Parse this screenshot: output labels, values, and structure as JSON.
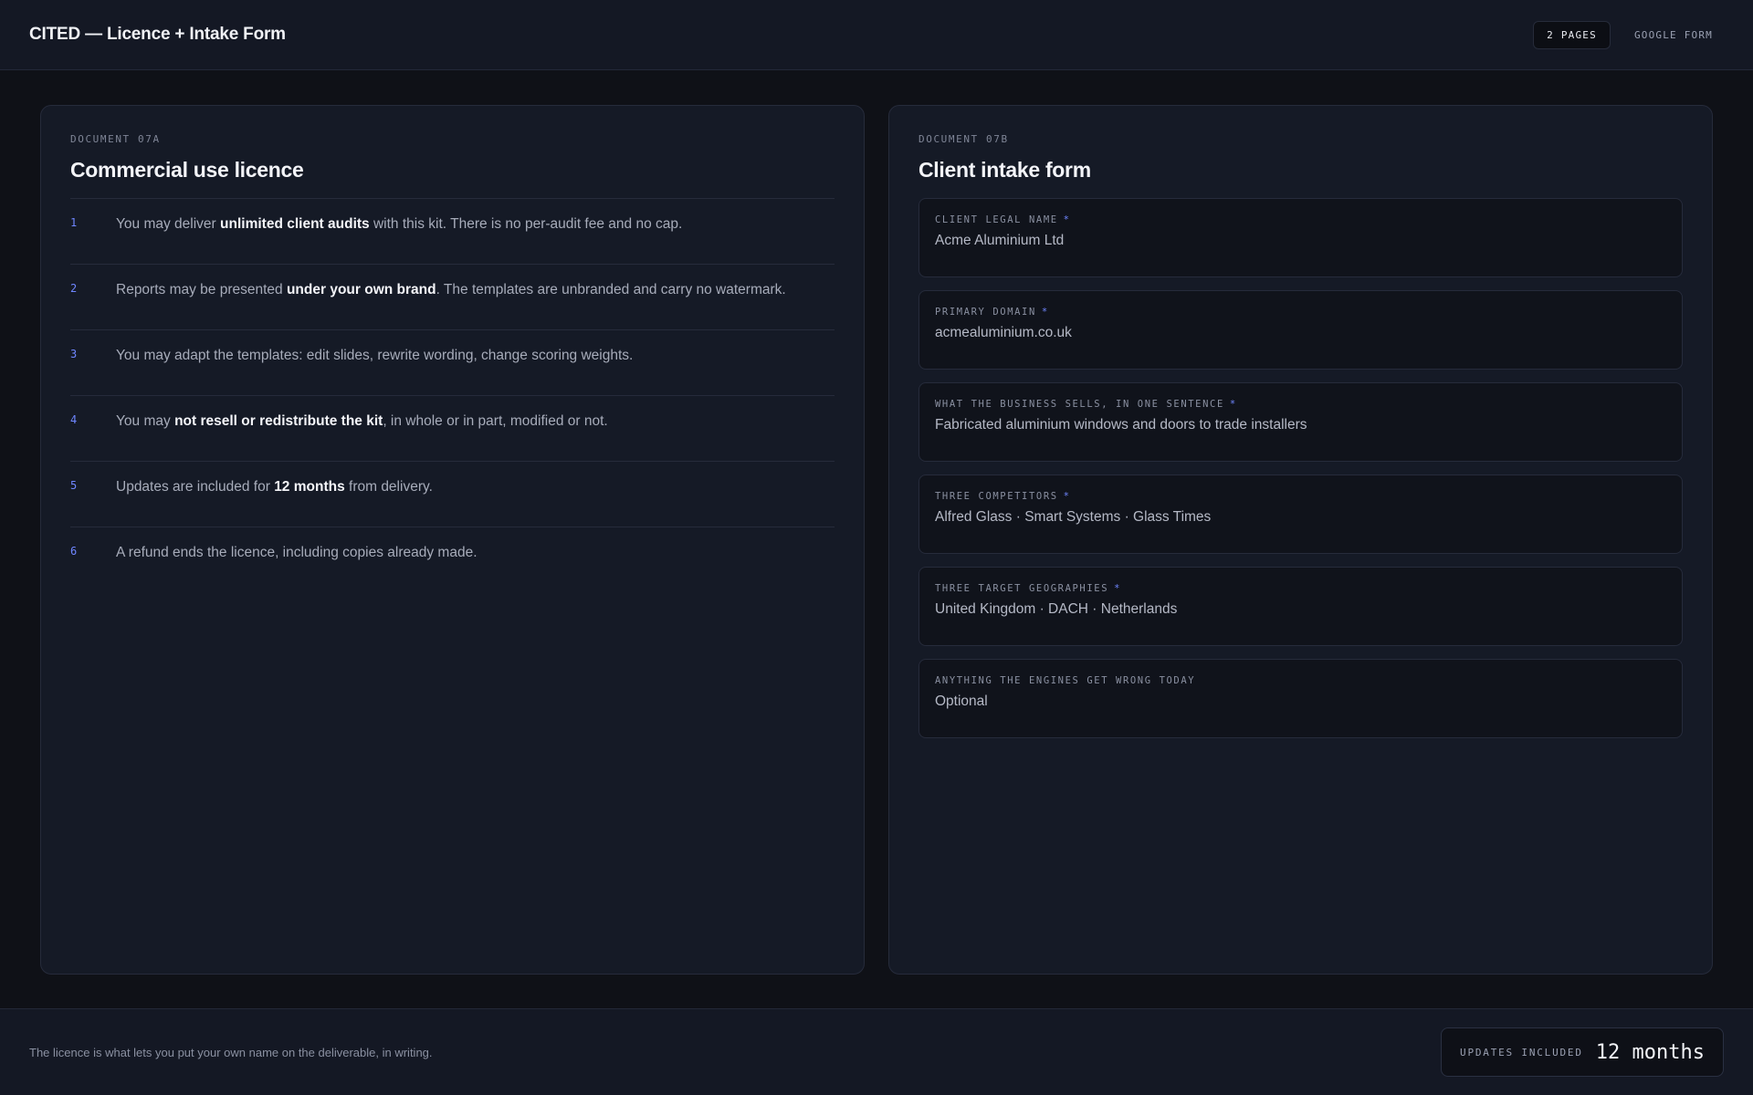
{
  "header": {
    "title": "CITED — Licence + Intake Form",
    "pages_badge": "2 PAGES",
    "google_form_link": "GOOGLE FORM"
  },
  "licence": {
    "kicker": "DOCUMENT 07A",
    "title": "Commercial use licence",
    "terms": [
      {
        "num": "1",
        "parts": [
          [
            "You may deliver ",
            false
          ],
          [
            "unlimited client audits",
            true
          ],
          [
            " with this kit. There is no per-audit fee and no cap.",
            false
          ]
        ]
      },
      {
        "num": "2",
        "parts": [
          [
            "Reports may be presented ",
            false
          ],
          [
            "under your own brand",
            true
          ],
          [
            ". The templates are unbranded and carry no watermark.",
            false
          ]
        ]
      },
      {
        "num": "3",
        "parts": [
          [
            "You may adapt the templates: edit slides, rewrite wording, change scoring weights.",
            false
          ]
        ]
      },
      {
        "num": "4",
        "parts": [
          [
            "You may ",
            false
          ],
          [
            "not resell or redistribute the kit",
            true
          ],
          [
            ", in whole or in part, modified or not.",
            false
          ]
        ]
      },
      {
        "num": "5",
        "parts": [
          [
            "Updates are included for ",
            false
          ],
          [
            "12 months",
            true
          ],
          [
            " from delivery.",
            false
          ]
        ]
      },
      {
        "num": "6",
        "parts": [
          [
            "A refund ends the licence, including copies already made.",
            false
          ]
        ]
      }
    ]
  },
  "intake": {
    "kicker": "DOCUMENT 07B",
    "title": "Client intake form",
    "required_marker": "*",
    "fields": [
      {
        "label": "CLIENT LEGAL NAME",
        "required": true,
        "value": "Acme Aluminium Ltd"
      },
      {
        "label": "PRIMARY DOMAIN",
        "required": true,
        "value": "acmealuminium.co.uk"
      },
      {
        "label": "WHAT THE BUSINESS SELLS, IN ONE SENTENCE",
        "required": true,
        "value": "Fabricated aluminium windows and doors to trade installers"
      },
      {
        "label": "THREE COMPETITORS",
        "required": true,
        "value": "Alfred Glass · Smart Systems · Glass Times"
      },
      {
        "label": "THREE TARGET GEOGRAPHIES",
        "required": true,
        "value": "United Kingdom · DACH · Netherlands"
      },
      {
        "label": "ANYTHING THE ENGINES GET WRONG TODAY",
        "required": false,
        "value": "Optional"
      }
    ]
  },
  "footer": {
    "note": "The licence is what lets you put your own name on the deliverable, in writing.",
    "updates_label": "UPDATES INCLUDED",
    "updates_value": "12 months"
  }
}
